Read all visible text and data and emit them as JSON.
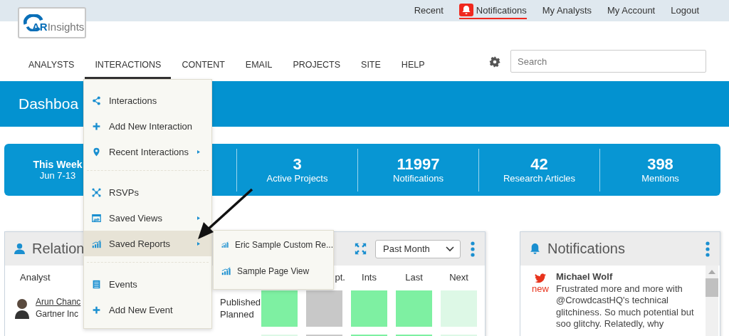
{
  "top_links": [
    {
      "label": "Recent",
      "selected": false
    },
    {
      "label": "Notifications",
      "selected": true
    },
    {
      "label": "My Analysts",
      "selected": false
    },
    {
      "label": "My Account",
      "selected": false
    },
    {
      "label": "Logout",
      "selected": false
    }
  ],
  "logo": {
    "mark": "AR",
    "name": "Insights"
  },
  "nav": {
    "items": [
      {
        "label": "ANALYSTS",
        "selected": false
      },
      {
        "label": "INTERACTIONS",
        "selected": true
      },
      {
        "label": "CONTENT",
        "selected": false
      },
      {
        "label": "EMAIL",
        "selected": false
      },
      {
        "label": "PROJECTS",
        "selected": false
      },
      {
        "label": "SITE",
        "selected": false
      },
      {
        "label": "HELP",
        "selected": false
      }
    ],
    "search": {
      "placeholder": "Search"
    }
  },
  "banner": {
    "title": "Dashboa"
  },
  "stats": [
    {
      "kind": "period",
      "value": "This Week",
      "label": "Jun 7-13"
    },
    {
      "kind": "count",
      "value": "3",
      "label": "Active Projects"
    },
    {
      "kind": "count",
      "value": "11997",
      "label": "Notifications"
    },
    {
      "kind": "count",
      "value": "42",
      "label": "Research Articles"
    },
    {
      "kind": "count",
      "value": "398",
      "label": "Mentions"
    }
  ],
  "dropdown": {
    "groups": [
      [
        {
          "label": "Interactions",
          "selected": false,
          "has_submenu": false
        },
        {
          "label": "Add New Interaction",
          "selected": false,
          "has_submenu": false
        },
        {
          "label": "Recent Interactions",
          "selected": false,
          "has_submenu": true
        }
      ],
      [
        {
          "label": "RSVPs",
          "selected": false,
          "has_submenu": false
        },
        {
          "label": "Saved Views",
          "selected": false,
          "has_submenu": true
        },
        {
          "label": "Saved Reports",
          "selected": true,
          "has_submenu": true
        }
      ],
      [
        {
          "label": "Events",
          "selected": false,
          "has_submenu": false
        },
        {
          "label": "Add New Event",
          "selected": false,
          "has_submenu": false
        }
      ]
    ],
    "submenu": [
      "Eric Sample Custom Re...",
      "Sample Page View"
    ]
  },
  "relationships_panel": {
    "title": "Relation",
    "period": "Past Month",
    "columns": [
      "Analyst",
      "pt.",
      "Ints",
      "Last",
      "Next"
    ],
    "rows": [
      {
        "name": "Arun Chanc",
        "org": "Gartner Inc",
        "statuses": [
          "Published",
          "Planned"
        ],
        "cells": [
          {
            "kind": "active"
          },
          {
            "kind": "inactive"
          },
          {
            "kind": "active"
          },
          {
            "kind": "active"
          },
          {
            "kind": "faint"
          }
        ]
      },
      {
        "cells": [
          {
            "kind": "faint"
          },
          {
            "kind": "inactive"
          },
          {
            "kind": "active"
          },
          {
            "kind": "active"
          },
          {
            "kind": "faint"
          }
        ]
      }
    ]
  },
  "notifications_panel": {
    "title": "Notifications",
    "items": [
      {
        "author": "Michael Wolf",
        "badge": "new",
        "text": "Frustrated more and more with @CrowdcastHQ's technical glitchiness. So much potential but soo glitchy. Relatedly, why"
      }
    ]
  }
}
